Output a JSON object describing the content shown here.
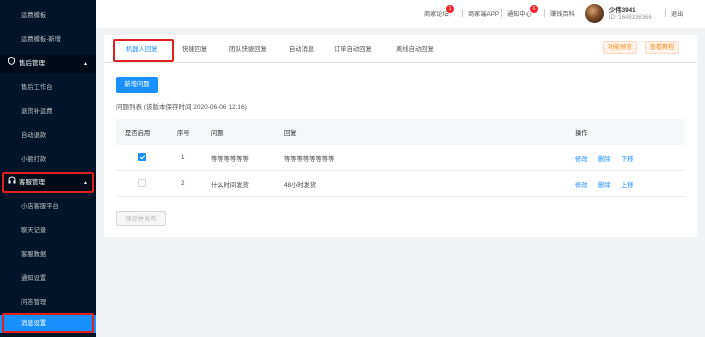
{
  "sidebar": {
    "items_top": [
      "运费模板",
      "运费模板-新增"
    ],
    "group_after_sales": "售后管理",
    "after_sales_items": [
      "售后工作台",
      "退货补运费",
      "自动退款",
      "小额打款"
    ],
    "group_customer_service": "客服管理",
    "customer_service_items": [
      "小店客服平台",
      "聊天记录",
      "客服数据",
      "通知设置",
      "问答管理",
      "消息设置"
    ]
  },
  "topbar": {
    "links": [
      "商家论坛",
      "商家端APP",
      "通知中心",
      "赚钱百科",
      "退出"
    ],
    "forum_badge": "1",
    "notice_badge": "6",
    "user_name": "少伟3941",
    "user_id": "ID: 1648336366"
  },
  "tabs": [
    "机器人回复",
    "快捷回复",
    "团队快捷回复",
    "自动消息",
    "订单自动回复",
    "离线自动回复"
  ],
  "actions": {
    "feature_preview": "功能预览",
    "view_tutorial": "查看教程"
  },
  "add_button": "新增问题",
  "list_title": "问题列表 (该版本保存时间 2020-06-06 12:16)",
  "table": {
    "headers": [
      "是否启用",
      "序号",
      "问题",
      "回复",
      "操作"
    ],
    "rows": [
      {
        "enabled": true,
        "index": "1",
        "question": "等等等等等等",
        "reply": "等等等等等等等等",
        "ops": [
          "修改",
          "删除",
          "下移"
        ]
      },
      {
        "enabled": false,
        "index": "2",
        "question": "什么时间发货",
        "reply": "48小时发货",
        "ops": [
          "修改",
          "删除",
          "上移"
        ]
      }
    ]
  },
  "save_button": "保存并发布",
  "colors": {
    "primary": "#1890ff",
    "sidebar": "#001529",
    "highlight": "#e02020",
    "badge": "#f5222d"
  }
}
